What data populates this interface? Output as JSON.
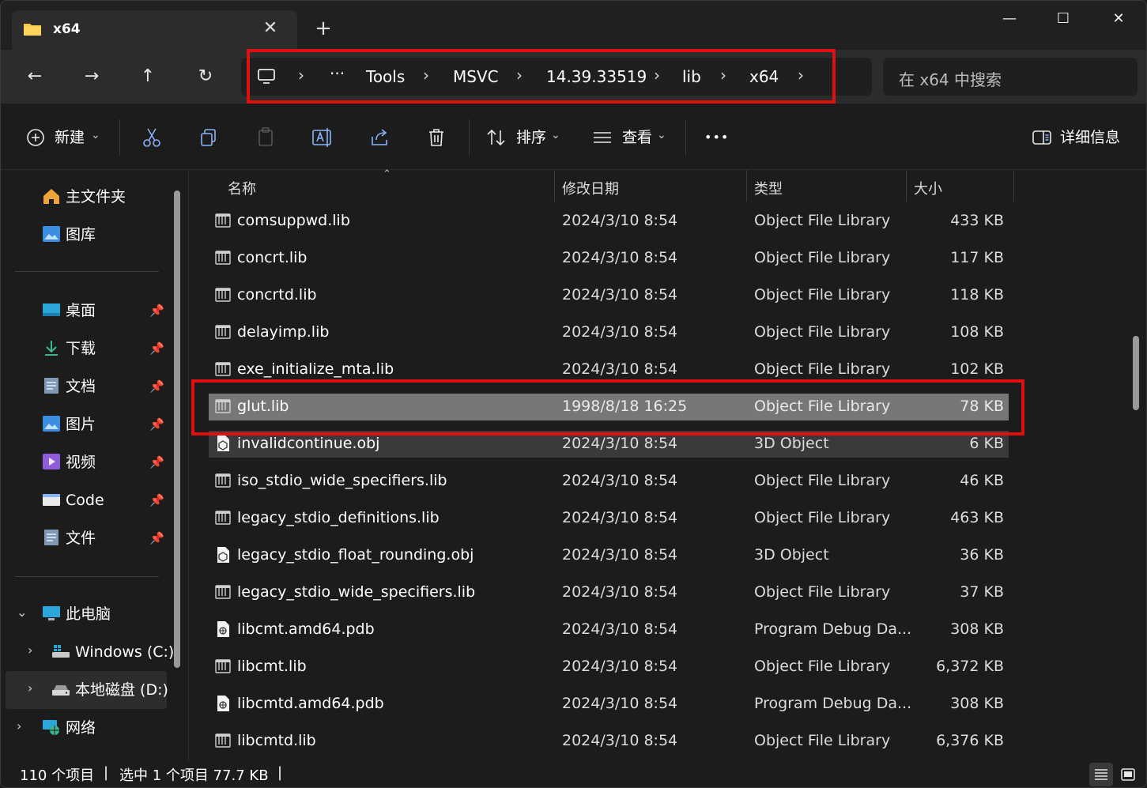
{
  "window": {
    "tab_title": "x64",
    "tab_close": "✕",
    "new_tab": "+",
    "minimize": "—",
    "maximize": "☐",
    "close": "✕"
  },
  "nav": {
    "back": "←",
    "forward": "→",
    "up": "↑",
    "refresh": "↻",
    "breadcrumb": [
      "Tools",
      "MSVC",
      "14.39.33519",
      "lib",
      "x64"
    ],
    "breadcrumb_more": "···",
    "separator": "›",
    "search_placeholder": "在 x64 中搜索"
  },
  "toolbar": {
    "new_label": "新建",
    "sort_label": "排序",
    "view_label": "查看",
    "more_label": "•••",
    "details_label": "详细信息",
    "dropdown": "⌄"
  },
  "sidebar": {
    "home": "主文件夹",
    "gallery": "图库",
    "quick": [
      {
        "label": "桌面",
        "icon": "desktop-icon"
      },
      {
        "label": "下载",
        "icon": "download-icon"
      },
      {
        "label": "文档",
        "icon": "documents-icon"
      },
      {
        "label": "图片",
        "icon": "pictures-icon"
      },
      {
        "label": "视频",
        "icon": "videos-icon"
      },
      {
        "label": "Code",
        "icon": "folder-icon"
      },
      {
        "label": "文件",
        "icon": "documents-icon"
      }
    ],
    "this_pc": "此电脑",
    "drive_c": "Windows (C:)",
    "drive_d": "本地磁盘 (D:)",
    "network": "网络"
  },
  "columns": {
    "name": "名称",
    "date": "修改日期",
    "type": "类型",
    "size": "大小"
  },
  "files": [
    {
      "name": "comsuppwd.lib",
      "date": "2024/3/10 8:54",
      "type": "Object File Library",
      "size": "433 KB",
      "icon": "lib"
    },
    {
      "name": "concrt.lib",
      "date": "2024/3/10 8:54",
      "type": "Object File Library",
      "size": "117 KB",
      "icon": "lib"
    },
    {
      "name": "concrtd.lib",
      "date": "2024/3/10 8:54",
      "type": "Object File Library",
      "size": "118 KB",
      "icon": "lib"
    },
    {
      "name": "delayimp.lib",
      "date": "2024/3/10 8:54",
      "type": "Object File Library",
      "size": "108 KB",
      "icon": "lib"
    },
    {
      "name": "exe_initialize_mta.lib",
      "date": "2024/3/10 8:54",
      "type": "Object File Library",
      "size": "102 KB",
      "icon": "lib"
    },
    {
      "name": "glut.lib",
      "date": "1998/8/18 16:25",
      "type": "Object File Library",
      "size": "78 KB",
      "icon": "lib",
      "state": "selected"
    },
    {
      "name": "invalidcontinue.obj",
      "date": "2024/3/10 8:54",
      "type": "3D Object",
      "size": "6 KB",
      "icon": "obj",
      "state": "hover"
    },
    {
      "name": "iso_stdio_wide_specifiers.lib",
      "date": "2024/3/10 8:54",
      "type": "Object File Library",
      "size": "46 KB",
      "icon": "lib"
    },
    {
      "name": "legacy_stdio_definitions.lib",
      "date": "2024/3/10 8:54",
      "type": "Object File Library",
      "size": "463 KB",
      "icon": "lib"
    },
    {
      "name": "legacy_stdio_float_rounding.obj",
      "date": "2024/3/10 8:54",
      "type": "3D Object",
      "size": "36 KB",
      "icon": "obj"
    },
    {
      "name": "legacy_stdio_wide_specifiers.lib",
      "date": "2024/3/10 8:54",
      "type": "Object File Library",
      "size": "37 KB",
      "icon": "lib"
    },
    {
      "name": "libcmt.amd64.pdb",
      "date": "2024/3/10 8:54",
      "type": "Program Debug Da...",
      "size": "308 KB",
      "icon": "pdb"
    },
    {
      "name": "libcmt.lib",
      "date": "2024/3/10 8:54",
      "type": "Object File Library",
      "size": "6,372 KB",
      "icon": "lib"
    },
    {
      "name": "libcmtd.amd64.pdb",
      "date": "2024/3/10 8:54",
      "type": "Program Debug Da...",
      "size": "308 KB",
      "icon": "pdb"
    },
    {
      "name": "libcmtd.lib",
      "date": "2024/3/10 8:54",
      "type": "Object File Library",
      "size": "6,376 KB",
      "icon": "lib"
    }
  ],
  "status": {
    "count": "110 个项目",
    "selection": "选中 1 个项目  77.7 KB",
    "sep": "|"
  },
  "colors": {
    "highlight_box": "#e01010",
    "selected_row": "#777777",
    "hover_row": "#3a3a3a"
  }
}
